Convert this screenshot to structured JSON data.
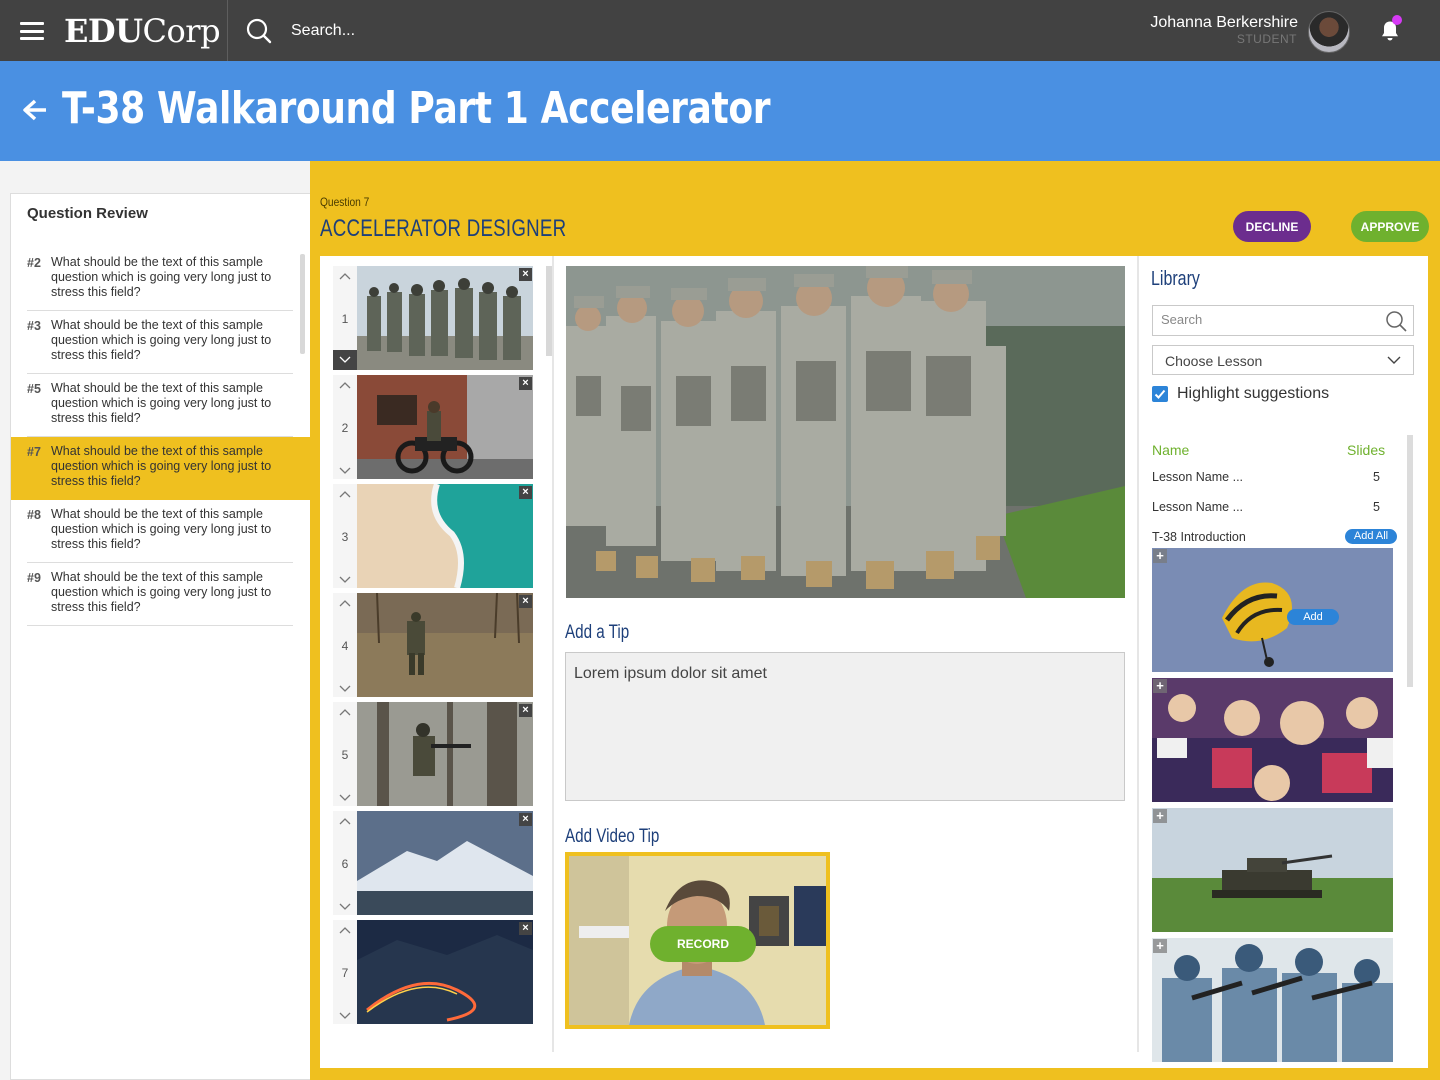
{
  "topbar": {
    "logo_bold": "EDU",
    "logo_rest": "Corp",
    "search_label": "Search...",
    "user_name": "Johanna Berkershire",
    "user_role": "STUDENT"
  },
  "header": {
    "title": "T-38 Walkaround Part 1 Accelerator"
  },
  "question_review": {
    "title": "Question Review",
    "items": [
      {
        "num": "#2",
        "text": "What should be the text of this sample question which is going very long just to stress this field?"
      },
      {
        "num": "#3",
        "text": "What should be the text of this sample question which is going very long just to stress this field?"
      },
      {
        "num": "#5",
        "text": "What should be the text of this sample question which is going very long just to stress this field?"
      },
      {
        "num": "#7",
        "text": "What should be the text of this sample question which is going very long just to stress this field?"
      },
      {
        "num": "#8",
        "text": "What should be the text of this sample question which is going very long just to stress this field?"
      },
      {
        "num": "#9",
        "text": "What should be the text of this sample question which is going very long just to stress this field?"
      }
    ]
  },
  "designer": {
    "question_label": "Question 7",
    "title": "ACCELERATOR DESIGNER",
    "decline_label": "DECLINE",
    "approve_label": "APPROVE",
    "thumbs": [
      "1",
      "2",
      "3",
      "4",
      "5",
      "6",
      "7"
    ],
    "tip_title": "Add a Tip",
    "tip_value": "Lorem ipsum dolor sit amet",
    "video_title": "Add Video Tip",
    "record_label": "RECORD"
  },
  "library": {
    "title": "Library",
    "search_placeholder": "Search",
    "lesson_select": "Choose Lesson",
    "highlight_label": "Highlight suggestions",
    "col_name": "Name",
    "col_slides": "Slides",
    "rows": [
      {
        "name": "Lesson Name ...",
        "slides": "5"
      },
      {
        "name": "Lesson Name ...",
        "slides": "5"
      }
    ],
    "group_name": "T-38 Introduction",
    "add_all_label": "Add All",
    "add_label": "Add"
  },
  "colors": {
    "topbar": "#424242",
    "header_blue": "#4a90e2",
    "accent_yellow": "#efc01f",
    "title_navy": "#1d3f7a",
    "decline_purple": "#6c2d8e",
    "approve_green": "#6fb12e",
    "link_blue": "#2c84d8"
  },
  "icons": [
    "hamburger-icon",
    "search-icon",
    "bell-icon",
    "back-arrow-icon",
    "chevron-up-icon",
    "chevron-down-icon",
    "close-icon",
    "plus-icon",
    "checkbox-checked-icon"
  ]
}
